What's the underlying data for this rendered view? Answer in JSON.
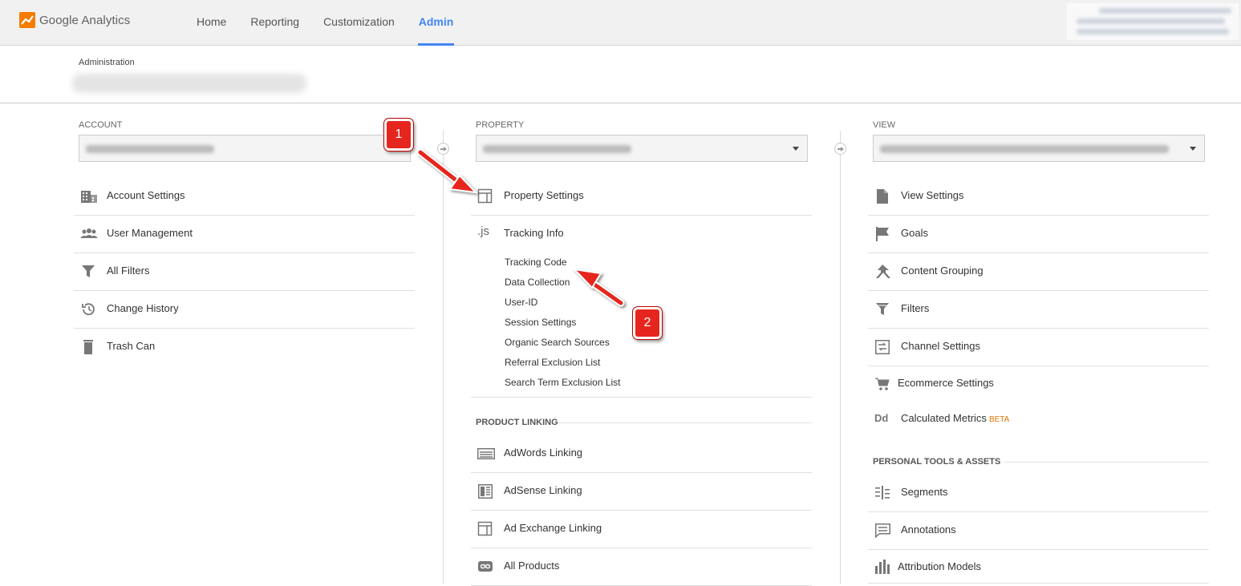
{
  "app": {
    "name_google": "Google",
    "name_analytics": "Analytics"
  },
  "nav": [
    {
      "label": "Home"
    },
    {
      "label": "Reporting"
    },
    {
      "label": "Customization"
    },
    {
      "label": "Admin",
      "active": true
    }
  ],
  "header": {
    "breadcrumb": "Administration"
  },
  "account": {
    "label": "ACCOUNT",
    "items": [
      {
        "label": "Account Settings",
        "icon": "building-icon"
      },
      {
        "label": "User Management",
        "icon": "people-icon"
      },
      {
        "label": "All Filters",
        "icon": "filter-icon"
      },
      {
        "label": "Change History",
        "icon": "history-icon"
      },
      {
        "label": "Trash Can",
        "icon": "trash-icon"
      }
    ]
  },
  "property": {
    "label": "PROPERTY",
    "items": [
      {
        "label": "Property Settings",
        "icon": "layout-icon"
      },
      {
        "label": "Tracking Info",
        "icon": "js-icon"
      }
    ],
    "tracking_sub": [
      {
        "label": "Tracking Code"
      },
      {
        "label": "Data Collection"
      },
      {
        "label": "User-ID"
      },
      {
        "label": "Session Settings"
      },
      {
        "label": "Organic Search Sources"
      },
      {
        "label": "Referral Exclusion List"
      },
      {
        "label": "Search Term Exclusion List"
      }
    ],
    "product_linking_head": "PRODUCT LINKING",
    "linking": [
      {
        "label": "AdWords Linking",
        "icon": "adwords-icon"
      },
      {
        "label": "AdSense Linking",
        "icon": "adsense-icon"
      },
      {
        "label": "Ad Exchange Linking",
        "icon": "ad-exchange-icon"
      },
      {
        "label": "All Products",
        "icon": "link-icon"
      }
    ]
  },
  "view": {
    "label": "VIEW",
    "items": [
      {
        "label": "View Settings",
        "icon": "document-icon"
      },
      {
        "label": "Goals",
        "icon": "flag-icon"
      },
      {
        "label": "Content Grouping",
        "icon": "content-grouping-icon"
      },
      {
        "label": "Filters",
        "icon": "filter-icon"
      },
      {
        "label": "Channel Settings",
        "icon": "channel-icon"
      },
      {
        "label": "Ecommerce Settings",
        "icon": "cart-icon"
      },
      {
        "label": "Calculated Metrics",
        "icon": "dd-icon",
        "badge": "BETA"
      }
    ],
    "personal_head": "PERSONAL TOOLS & ASSETS",
    "personal": [
      {
        "label": "Segments",
        "icon": "segments-icon"
      },
      {
        "label": "Annotations",
        "icon": "annotation-icon"
      },
      {
        "label": "Attribution Models",
        "icon": "attribution-icon"
      }
    ],
    "dd_glyph": "Dd"
  },
  "js_glyph": ".js",
  "annotations": [
    {
      "label": "1"
    },
    {
      "label": "2"
    }
  ],
  "colors": {
    "accent": "#4285f4",
    "annotation_red": "#e6261e",
    "beta": "#e37400"
  }
}
